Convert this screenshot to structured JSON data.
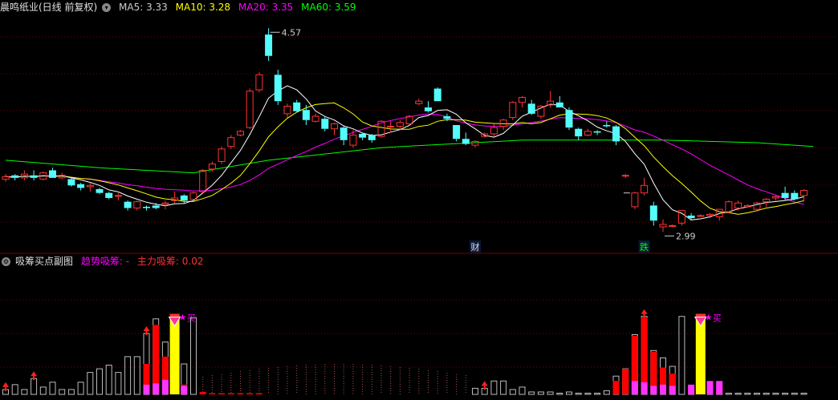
{
  "header": {
    "title": "晨鸣纸业(日线 前复权)",
    "ma": [
      {
        "label": "MA5:",
        "value": "3.33",
        "color": "#ffffff"
      },
      {
        "label": "MA10:",
        "value": "3.28",
        "color": "#ffff00"
      },
      {
        "label": "MA20:",
        "value": "3.35",
        "color": "#ff00ff"
      },
      {
        "label": "MA60:",
        "value": "3.59",
        "color": "#00ff00"
      }
    ]
  },
  "sub_header": {
    "title": "吸筹买点副图",
    "items": [
      {
        "label": "趋势吸筹:",
        "value": "-",
        "color": "#ff00ff"
      },
      {
        "label": "主力吸筹:",
        "value": "0.02",
        "color": "#ff3333"
      }
    ]
  },
  "colors": {
    "up": "#ff3333",
    "down": "#54fcfc",
    "ma5": "#ffffff",
    "ma10": "#ffff00",
    "ma20": "#ff00ff",
    "ma60": "#00ff00",
    "grid": "#7a0000"
  },
  "annotations": {
    "high": "4.57",
    "low": "2.99",
    "cai": "财",
    "die": "跌",
    "buy": "买"
  },
  "chart_data": [
    {
      "type": "candlestick",
      "ylim": [
        2.85,
        4.68
      ],
      "ohlc": [
        [
          3.37,
          3.41,
          3.35,
          3.39
        ],
        [
          3.4,
          3.41,
          3.36,
          3.38
        ],
        [
          3.38,
          3.44,
          3.36,
          3.41
        ],
        [
          3.4,
          3.44,
          3.36,
          3.38
        ],
        [
          3.37,
          3.43,
          3.36,
          3.42
        ],
        [
          3.44,
          3.46,
          3.38,
          3.38
        ],
        [
          3.38,
          3.42,
          3.37,
          3.4
        ],
        [
          3.37,
          3.38,
          3.31,
          3.32
        ],
        [
          3.33,
          3.34,
          3.28,
          3.3
        ],
        [
          3.31,
          3.34,
          3.27,
          3.32
        ],
        [
          3.29,
          3.3,
          3.25,
          3.26
        ],
        [
          3.26,
          3.27,
          3.21,
          3.22
        ],
        [
          3.24,
          3.26,
          3.2,
          3.24
        ],
        [
          3.19,
          3.2,
          3.12,
          3.14
        ],
        [
          3.14,
          3.2,
          3.12,
          3.19
        ],
        [
          3.15,
          3.16,
          3.12,
          3.14
        ],
        [
          3.16,
          3.18,
          3.13,
          3.14
        ],
        [
          3.17,
          3.2,
          3.13,
          3.18
        ],
        [
          3.2,
          3.27,
          3.18,
          3.22
        ],
        [
          3.24,
          3.25,
          3.18,
          3.2
        ],
        [
          3.21,
          3.27,
          3.2,
          3.26
        ],
        [
          3.27,
          3.45,
          3.26,
          3.44
        ],
        [
          3.45,
          3.51,
          3.43,
          3.49
        ],
        [
          3.51,
          3.63,
          3.49,
          3.61
        ],
        [
          3.63,
          3.72,
          3.61,
          3.7
        ],
        [
          3.72,
          3.76,
          3.71,
          3.75
        ],
        [
          3.78,
          4.09,
          3.77,
          4.07
        ],
        [
          4.08,
          4.22,
          4.06,
          4.2
        ],
        [
          4.52,
          4.57,
          4.31,
          4.35
        ],
        [
          4.2,
          4.24,
          3.96,
          3.99
        ],
        [
          3.89,
          3.97,
          3.86,
          3.95
        ],
        [
          3.98,
          4.0,
          3.9,
          3.91
        ],
        [
          3.92,
          3.96,
          3.8,
          3.84
        ],
        [
          3.83,
          3.89,
          3.82,
          3.87
        ],
        [
          3.85,
          3.87,
          3.75,
          3.77
        ],
        [
          3.77,
          3.82,
          3.72,
          3.81
        ],
        [
          3.78,
          3.79,
          3.64,
          3.68
        ],
        [
          3.64,
          3.76,
          3.62,
          3.72
        ],
        [
          3.73,
          3.74,
          3.68,
          3.7
        ],
        [
          3.72,
          3.73,
          3.66,
          3.68
        ],
        [
          3.71,
          3.84,
          3.7,
          3.83
        ],
        [
          3.79,
          3.83,
          3.74,
          3.79
        ],
        [
          3.79,
          3.84,
          3.76,
          3.82
        ],
        [
          3.81,
          3.88,
          3.8,
          3.87
        ],
        [
          3.97,
          4.01,
          3.96,
          3.99
        ],
        [
          3.94,
          3.99,
          3.9,
          3.91
        ],
        [
          4.09,
          4.1,
          3.99,
          3.99
        ],
        [
          3.87,
          3.89,
          3.83,
          3.85
        ],
        [
          3.8,
          3.8,
          3.67,
          3.69
        ],
        [
          3.69,
          3.74,
          3.64,
          3.65
        ],
        [
          3.64,
          3.68,
          3.62,
          3.67
        ],
        [
          3.71,
          3.74,
          3.7,
          3.73
        ],
        [
          3.73,
          3.81,
          3.71,
          3.78
        ],
        [
          3.79,
          3.85,
          3.76,
          3.84
        ],
        [
          3.86,
          3.99,
          3.84,
          3.98
        ],
        [
          3.98,
          4.03,
          3.94,
          4.02
        ],
        [
          3.97,
          4.0,
          3.88,
          3.89
        ],
        [
          3.87,
          3.96,
          3.85,
          3.95
        ],
        [
          3.96,
          4.07,
          3.94,
          3.99
        ],
        [
          3.98,
          4.03,
          3.94,
          3.94
        ],
        [
          3.92,
          3.94,
          3.76,
          3.78
        ],
        [
          3.77,
          3.78,
          3.68,
          3.71
        ],
        [
          3.72,
          3.77,
          3.71,
          3.75
        ],
        [
          3.75,
          3.76,
          3.72,
          3.74
        ],
        [
          3.8,
          3.83,
          3.78,
          3.79
        ],
        [
          3.79,
          3.8,
          3.64,
          3.67
        ],
        [
          3.4,
          3.41,
          3.38,
          3.4
        ],
        [
          3.15,
          3.27,
          3.13,
          3.26
        ],
        [
          3.26,
          3.38,
          3.24,
          3.32
        ],
        [
          3.16,
          3.19,
          3.0,
          3.04
        ],
        [
          2.99,
          3.05,
          2.95,
          3.01
        ],
        [
          3.0,
          3.01,
          2.99,
          3.0
        ],
        [
          3.02,
          3.12,
          3.0,
          3.12
        ],
        [
          3.08,
          3.1,
          3.04,
          3.06
        ],
        [
          3.08,
          3.09,
          3.07,
          3.08
        ],
        [
          3.08,
          3.1,
          3.06,
          3.09
        ],
        [
          3.07,
          3.13,
          3.04,
          3.13
        ],
        [
          3.11,
          3.2,
          3.1,
          3.19
        ],
        [
          3.14,
          3.2,
          3.12,
          3.18
        ],
        [
          3.15,
          3.17,
          3.14,
          3.16
        ],
        [
          3.13,
          3.19,
          3.11,
          3.18
        ],
        [
          3.19,
          3.22,
          3.15,
          3.21
        ],
        [
          3.22,
          3.24,
          3.2,
          3.23
        ],
        [
          3.26,
          3.31,
          3.2,
          3.22
        ],
        [
          3.26,
          3.28,
          3.2,
          3.21
        ],
        [
          3.24,
          3.29,
          3.19,
          3.28
        ]
      ],
      "ma60_x": [
        0,
        10,
        20,
        28,
        40,
        55,
        70,
        80,
        86
      ],
      "ma60_y": [
        3.52,
        3.46,
        3.42,
        3.52,
        3.62,
        3.68,
        3.68,
        3.66,
        3.63
      ]
    },
    {
      "type": "bar",
      "ylim": [
        0,
        100
      ],
      "outline": [
        4,
        8,
        4,
        13,
        6,
        10,
        4,
        4,
        10,
        18,
        21,
        24,
        18,
        31,
        31,
        50,
        62,
        43,
        31,
        25,
        63,
        1,
        1,
        1,
        1,
        1,
        1,
        1,
        1,
        1,
        1,
        1,
        1,
        1,
        1,
        1,
        1,
        1,
        1,
        1,
        1,
        1,
        1,
        1,
        1,
        1,
        1,
        1,
        1,
        1,
        5,
        5,
        11,
        11,
        4,
        6,
        2,
        2,
        2,
        1,
        2,
        1,
        1,
        1,
        3,
        15,
        21,
        49,
        64,
        36,
        30,
        23,
        64,
        1,
        1,
        1,
        1,
        1,
        1,
        1,
        1,
        1,
        1,
        1,
        1,
        1
      ],
      "red": [
        0,
        0,
        0,
        0,
        0,
        0,
        0,
        0,
        0,
        0,
        0,
        0,
        0,
        0,
        0,
        25,
        57,
        31,
        0,
        8,
        0,
        2,
        1,
        1,
        1,
        1,
        1,
        1,
        0,
        0,
        0,
        0,
        0,
        0,
        0,
        0,
        0,
        0,
        0,
        0,
        0,
        0,
        0,
        0,
        0,
        0,
        0,
        0,
        0,
        0,
        0,
        0,
        0,
        0,
        0,
        0,
        0,
        0,
        0,
        0,
        0,
        0,
        0,
        0,
        0,
        11,
        21,
        48,
        63,
        35,
        22,
        17,
        0,
        5,
        5,
        7,
        7,
        0,
        0,
        0,
        0,
        0,
        0,
        0,
        0,
        0
      ],
      "magenta": [
        0,
        0,
        0,
        0,
        0,
        0,
        0,
        0,
        0,
        0,
        0,
        0,
        0,
        0,
        0,
        8,
        9,
        12,
        4,
        7,
        0,
        0,
        0,
        0,
        0,
        0,
        0,
        0,
        0,
        0,
        0,
        0,
        0,
        0,
        0,
        0,
        0,
        0,
        0,
        0,
        0,
        0,
        0,
        0,
        0,
        0,
        0,
        0,
        0,
        0,
        0,
        0,
        0,
        0,
        0,
        0,
        0,
        0,
        0,
        0,
        0,
        0,
        0,
        0,
        0,
        0,
        0,
        11,
        10,
        7,
        8,
        7,
        0,
        8,
        9,
        11,
        11,
        0,
        0,
        0,
        0,
        0,
        0,
        0,
        0,
        0
      ],
      "yellow_idx": [
        18,
        74
      ],
      "yellow_value": 66,
      "arrow_idx": [
        0,
        3,
        15,
        51,
        68
      ],
      "dots_idx_range": [
        19,
        50
      ]
    }
  ]
}
